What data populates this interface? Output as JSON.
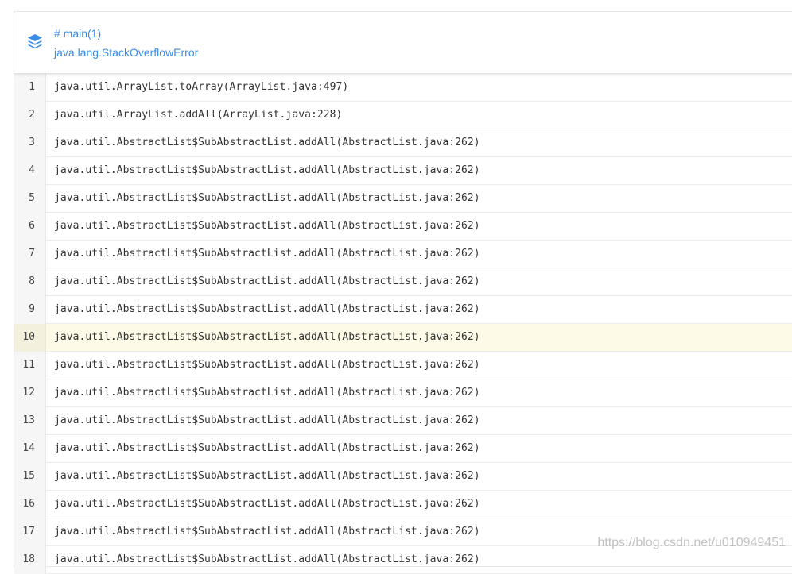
{
  "header": {
    "thread": "# main(1)",
    "error": "java.lang.StackOverflowError",
    "icon": "layers-icon",
    "accent_color": "#3a8ee6"
  },
  "stack": {
    "highlighted_line": 10,
    "highlight_color": "#fdfbe7",
    "lines": [
      {
        "n": "1",
        "text": "java.util.ArrayList.toArray(ArrayList.java:497)"
      },
      {
        "n": "2",
        "text": "java.util.ArrayList.addAll(ArrayList.java:228)"
      },
      {
        "n": "3",
        "text": "java.util.AbstractList$SubAbstractList.addAll(AbstractList.java:262)"
      },
      {
        "n": "4",
        "text": "java.util.AbstractList$SubAbstractList.addAll(AbstractList.java:262)"
      },
      {
        "n": "5",
        "text": "java.util.AbstractList$SubAbstractList.addAll(AbstractList.java:262)"
      },
      {
        "n": "6",
        "text": "java.util.AbstractList$SubAbstractList.addAll(AbstractList.java:262)"
      },
      {
        "n": "7",
        "text": "java.util.AbstractList$SubAbstractList.addAll(AbstractList.java:262)"
      },
      {
        "n": "8",
        "text": "java.util.AbstractList$SubAbstractList.addAll(AbstractList.java:262)"
      },
      {
        "n": "9",
        "text": "java.util.AbstractList$SubAbstractList.addAll(AbstractList.java:262)"
      },
      {
        "n": "10",
        "text": "java.util.AbstractList$SubAbstractList.addAll(AbstractList.java:262)"
      },
      {
        "n": "11",
        "text": "java.util.AbstractList$SubAbstractList.addAll(AbstractList.java:262)"
      },
      {
        "n": "12",
        "text": "java.util.AbstractList$SubAbstractList.addAll(AbstractList.java:262)"
      },
      {
        "n": "13",
        "text": "java.util.AbstractList$SubAbstractList.addAll(AbstractList.java:262)"
      },
      {
        "n": "14",
        "text": "java.util.AbstractList$SubAbstractList.addAll(AbstractList.java:262)"
      },
      {
        "n": "15",
        "text": "java.util.AbstractList$SubAbstractList.addAll(AbstractList.java:262)"
      },
      {
        "n": "16",
        "text": "java.util.AbstractList$SubAbstractList.addAll(AbstractList.java:262)"
      },
      {
        "n": "17",
        "text": "java.util.AbstractList$SubAbstractList.addAll(AbstractList.java:262)"
      },
      {
        "n": "18",
        "text": "java.util.AbstractList$SubAbstractList.addAll(AbstractList.java:262)"
      }
    ]
  },
  "watermark": "https://blog.csdn.net/u010949451"
}
